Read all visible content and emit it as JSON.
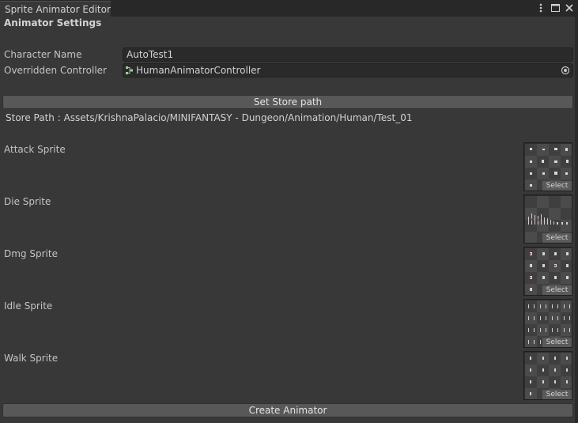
{
  "window": {
    "tab_title": "Sprite Animator Editor",
    "icons": [
      "kebab-menu-icon",
      "maximize-icon",
      "close-icon"
    ]
  },
  "section_header": "Animator Settings",
  "fields": {
    "character_name_label": "Character Name",
    "character_name_value": "AutoTest1",
    "controller_label": "Overridden Controller",
    "controller_value": "HumanAnimatorController"
  },
  "store": {
    "button_label": "Set Store path",
    "path_text": "Store Path : Assets/KrishnaPalacio/MINIFANTASY - Dungeon/Animation/Human/Test_01"
  },
  "sprites": [
    {
      "label": "Attack Sprite",
      "select_label": "Select"
    },
    {
      "label": "Die Sprite",
      "select_label": "Select"
    },
    {
      "label": "Dmg Sprite",
      "select_label": "Select"
    },
    {
      "label": "Idle Sprite",
      "select_label": "Select"
    },
    {
      "label": "Walk Sprite",
      "select_label": "Select"
    }
  ],
  "create_button_label": "Create Animator",
  "colors": {
    "background": "#383838",
    "field": "#2a2a2a",
    "button": "#585858",
    "text": "#c4c4c4"
  }
}
